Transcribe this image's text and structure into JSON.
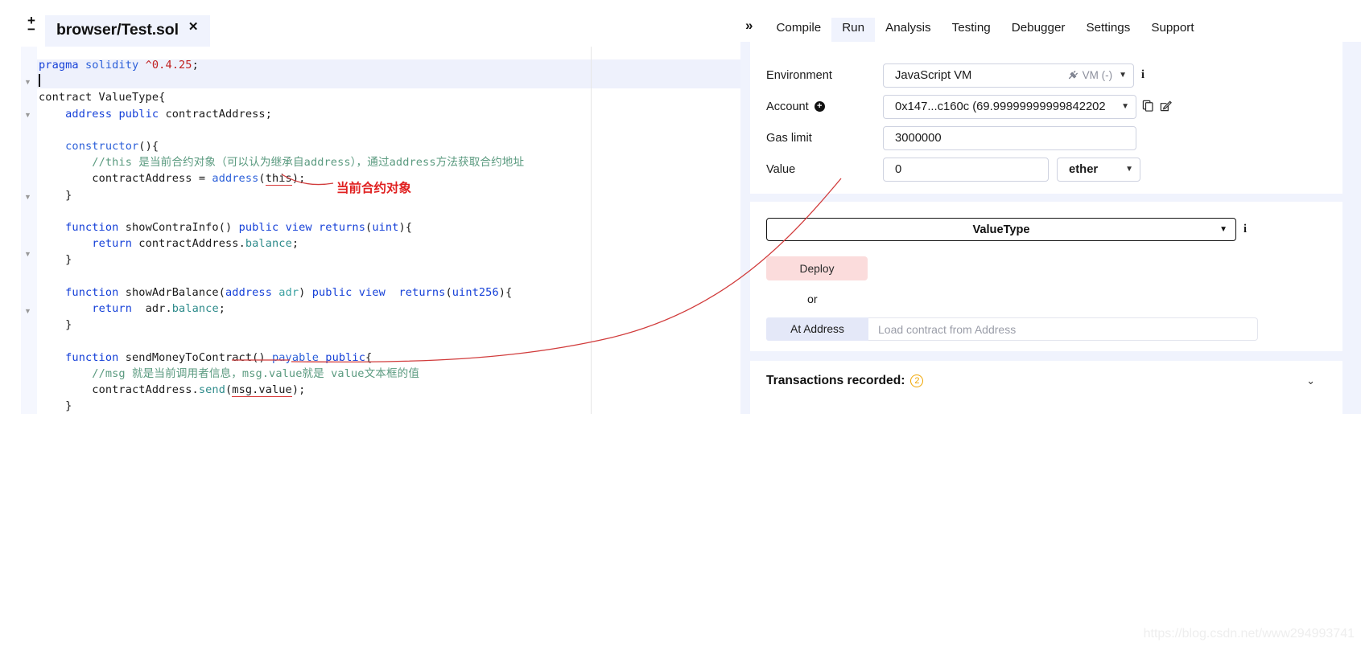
{
  "editor": {
    "zoom_in": "+",
    "zoom_out": "−",
    "tab_label": "browser/Test.sol",
    "tab_close": "✕",
    "code_lines": [
      "pragma solidity ^0.4.25;",
      "",
      "contract ValueType{",
      "    address public contractAddress;",
      "",
      "    constructor(){",
      "        //this 是当前合约对象（可以认为继承自address），通过address方法获取合约地址",
      "        contractAddress = address(this);",
      "    }",
      "",
      "    function showContraInfo() public view returns(uint){",
      "        return contractAddress.balance;",
      "    }",
      "",
      "    function showAdrBalance(address adr) public view  returns(uint256){",
      "        return  adr.balance;",
      "    }",
      "",
      "    function sendMoneyToContract() payable public{",
      "        //msg 就是当前调用者信息，msg.value就是 value文本框的值",
      "        contractAddress.send(msg.value);",
      "    }",
      "}"
    ]
  },
  "panel": {
    "expand_icon": "»",
    "tabs": [
      {
        "label": "Compile",
        "active": false
      },
      {
        "label": "Run",
        "active": true
      },
      {
        "label": "Analysis",
        "active": false
      },
      {
        "label": "Testing",
        "active": false
      },
      {
        "label": "Debugger",
        "active": false
      },
      {
        "label": "Settings",
        "active": false
      },
      {
        "label": "Support",
        "active": false
      }
    ],
    "run": {
      "environment_label": "Environment",
      "environment_value": "JavaScript VM",
      "environment_status": "VM (-)",
      "environment_caret": "▼",
      "account_label": "Account",
      "account_add": "+",
      "account_value": "0x147...c160c (69.99999999999842202",
      "account_caret": "▼",
      "account_copy_icon": "copy-icon",
      "account_edit_icon": "edit-icon",
      "gas_limit_label": "Gas limit",
      "gas_limit_value": "3000000",
      "value_label": "Value",
      "value_value": "0",
      "value_unit": "ether",
      "value_unit_caret": "▼",
      "info_icon": "i",
      "contract_select_value": "ValueType",
      "contract_select_caret": "▼",
      "deploy_label": "Deploy",
      "or_label": "or",
      "at_address_label": "At Address",
      "at_address_placeholder": "Load contract from Address",
      "transactions_title": "Transactions recorded:",
      "transactions_count": "2",
      "transactions_chevron": "⌄"
    }
  },
  "annotations": {
    "label_1": "当前合约对象",
    "arrow_color": "#d13b3b"
  },
  "watermark": "https://blog.csdn.net/www294993741"
}
